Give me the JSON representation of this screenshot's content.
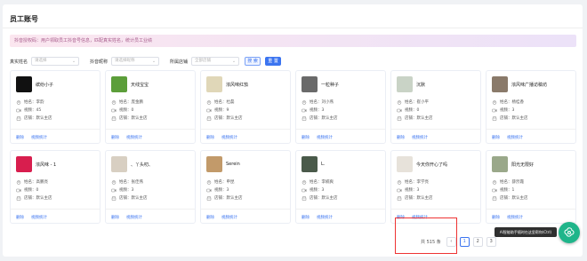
{
  "page": {
    "title": "员工账号",
    "notice": "抖音授权码：用户领取员工抖音号信息，匹配真实姓名，统计员工业绩"
  },
  "filters": {
    "real_name_label": "真实姓名",
    "real_name_placeholder": "请选择",
    "nickname_label": "抖音昵称",
    "nickname_placeholder": "请选择昵称",
    "store_label": "所属店铺",
    "store_placeholder": "全部店铺",
    "search_label": "搜 索",
    "reset_label": "重 置"
  },
  "card_labels": {
    "name_prefix": "姓名：",
    "video_prefix": "视频：",
    "store_prefix": "店铺：",
    "delete": "删除",
    "video_stats": "视频统计"
  },
  "cards": [
    {
      "nickname": "缤纷小子",
      "name": "李韵",
      "videos": "45",
      "store": "默认主店",
      "avatar_color": "#111111"
    },
    {
      "nickname": "天线宝宝",
      "name": "庞金鹏",
      "videos": "0",
      "store": "默认主店",
      "avatar_color": "#5c9e3a"
    },
    {
      "nickname": "浓风味红茄",
      "name": "杜磊",
      "videos": "9",
      "store": "默认主店",
      "avatar_color": "#e0d7b8"
    },
    {
      "nickname": "一粒种子",
      "name": "刘小燕",
      "videos": "3",
      "store": "默认主店",
      "avatar_color": "#6a6a6a"
    },
    {
      "nickname": "沉默",
      "name": "崔小平",
      "videos": "0",
      "store": "默认主店",
      "avatar_color": "#c9d3c6"
    },
    {
      "nickname": "浓风味广播访稿坊",
      "name": "杨桂香",
      "videos": "3",
      "store": "默认主店",
      "avatar_color": "#8a7a6a"
    },
    {
      "nickname": "浓风味 - 1",
      "name": "高鹏亮",
      "videos": "0",
      "store": "默认主店",
      "avatar_color": "#d81e4e"
    },
    {
      "nickname": "、丫头叨、",
      "name": "张佳燕",
      "videos": "3",
      "store": "默认主店",
      "avatar_color": "#d8cfc2"
    },
    {
      "nickname": "Serein",
      "name": "申昆",
      "videos": "3",
      "store": "默认主店",
      "avatar_color": "#c29a6a"
    },
    {
      "nickname": "L.",
      "name": "李楠爽",
      "videos": "3",
      "store": "默认主店",
      "avatar_color": "#4a5a4a"
    },
    {
      "nickname": "今天你开心了吗",
      "name": "李学亮",
      "videos": "3",
      "store": "默认主店",
      "avatar_color": "#e7e2da"
    },
    {
      "nickname": "阳光无限好",
      "name": "薛烈霞",
      "videos": "1",
      "store": "默认主店",
      "avatar_color": "#9aa88a"
    }
  ],
  "pagination": {
    "total": "共 515 条",
    "prev": "‹",
    "pages": [
      "1",
      "2",
      "3"
    ],
    "current": "1"
  },
  "tooltip": "AI智能助手随时在这里帮你(Ctrl)",
  "colors": {
    "accent": "#3b74f0",
    "highlight": "#ee3333",
    "fab": "#1fb58a"
  },
  "icons": {
    "name": "user-circle-icon",
    "video": "video-icon",
    "store": "store-icon",
    "fab": "ai-assistant-icon"
  }
}
